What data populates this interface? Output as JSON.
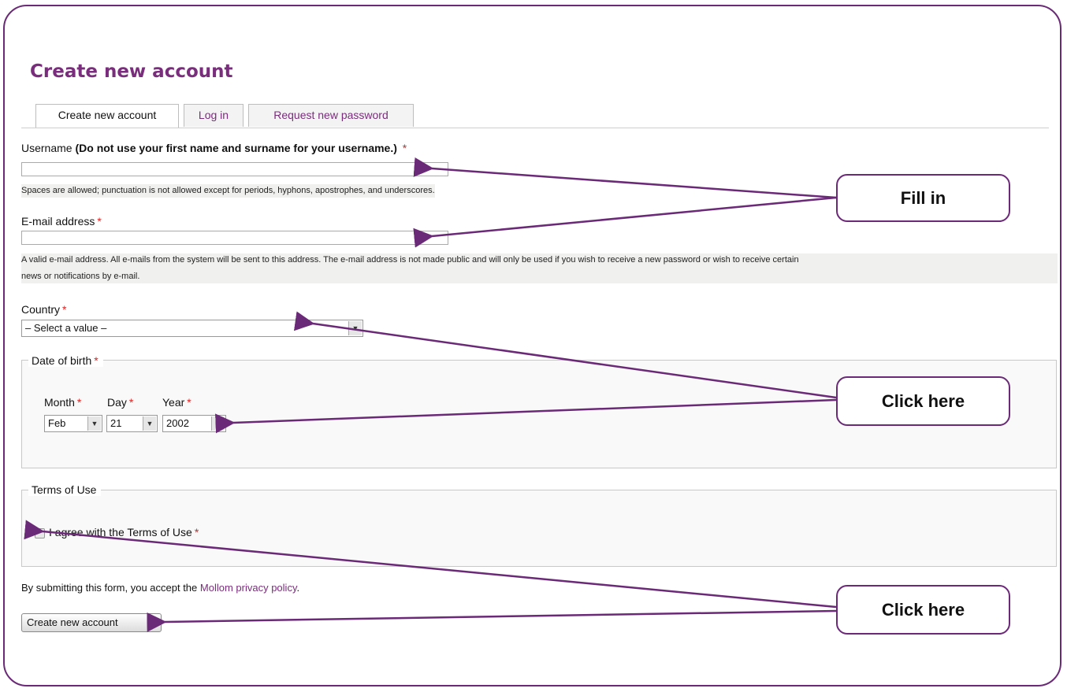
{
  "page": {
    "title": "Create new account"
  },
  "tabs": [
    {
      "label": "Create new account",
      "active": true
    },
    {
      "label": "Log in",
      "active": false
    },
    {
      "label": "Request new password",
      "active": false
    }
  ],
  "username": {
    "label": "Username",
    "label_note": "(Do not use your first name and surname for your username.)",
    "required": "*",
    "value": "",
    "description": "Spaces are allowed; punctuation is not allowed except for periods, hyphons, apostrophes, and underscores."
  },
  "email": {
    "label": "E-mail address",
    "required": "*",
    "value": "",
    "description_line1": "A valid e-mail address. All e-mails from the system will be sent to this address. The e-mail address is not made public and will only be used if you wish to receive a new password or wish to receive certain",
    "description_line2": "news or notifications by e-mail."
  },
  "country": {
    "label": "Country",
    "required": "*",
    "selected": "– Select a value –"
  },
  "dob": {
    "legend": "Date of birth",
    "required": "*",
    "month": {
      "label": "Month",
      "selected": "Feb"
    },
    "day": {
      "label": "Day",
      "selected": "21"
    },
    "year": {
      "label": "Year",
      "selected": "2002"
    }
  },
  "terms": {
    "legend": "Terms of Use",
    "checkbox_label": "I agree with the Terms of Use",
    "required": "*",
    "checked": false
  },
  "privacy": {
    "text": "By submitting this form, you accept the",
    "link": "Mollom privacy policy",
    "suffix": "."
  },
  "submit": {
    "label": "Create new account"
  },
  "callouts": {
    "fill_in": "Fill in",
    "click_here_1": "Click here",
    "click_here_2": "Click here"
  },
  "colors": {
    "accent": "#6b2a78",
    "title": "#7a2d7c",
    "required": "#dd2222"
  }
}
